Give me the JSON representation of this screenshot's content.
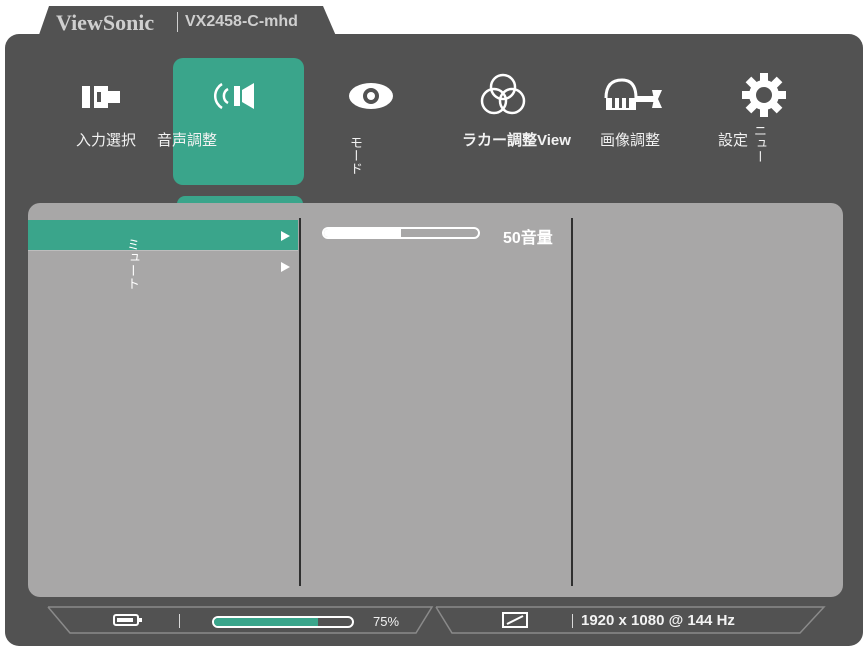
{
  "header": {
    "brand": "ViewSonic",
    "model": "VX2458-C-mhd"
  },
  "menu": [
    {
      "label": "入力選択",
      "icon": "input-select-icon",
      "active": false
    },
    {
      "label": "音声調整",
      "icon": "speaker-icon",
      "active": true
    },
    {
      "label": "モード",
      "icon": "eye-icon",
      "active": false
    },
    {
      "label": "ラカー調整View",
      "icon": "color-circles-icon",
      "active": false
    },
    {
      "label": "画像調整",
      "icon": "hand-wrench-icon",
      "active": false
    },
    {
      "label": "設定",
      "icon": "gear-icon",
      "active": false
    },
    {
      "label_extra": "ニュー"
    }
  ],
  "submenu": {
    "items": [
      "ミュート"
    ],
    "selected_index": 0
  },
  "volume": {
    "value": 50,
    "label": "50音量",
    "fraction": 0.5
  },
  "status": {
    "brightness_pct": "75%",
    "brightness_fraction": 0.75,
    "resolution": "1920 x 1080 @ 144 Hz"
  },
  "colors": {
    "accent": "#3aa58b",
    "frame": "#525252",
    "panel": "#a8a7a7"
  }
}
